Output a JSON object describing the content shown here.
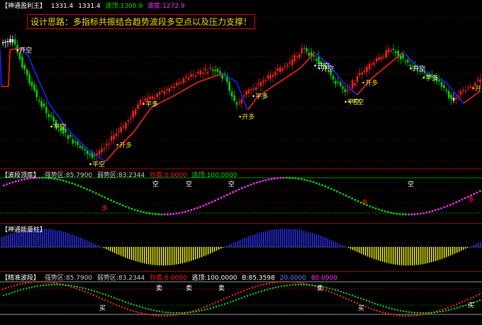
{
  "colors": {
    "up_candle": "#ff2020",
    "down_candle": "#00e000",
    "doji_candle": "#ffffff",
    "ma_up": "#ff2020",
    "ma_down": "#2020ff",
    "title_main": "#ffffff",
    "wave_top": "#00e000",
    "wave_bottom": "#ff30ff",
    "energy_top": "#ffff00",
    "energy_bottom": "#3030ff",
    "grid": "#a00000"
  },
  "panels": {
    "main": {
      "name": "【神通盈利王】",
      "v1": "1331.4",
      "v2": "1331.4",
      "top_label": "波顶:1300.9",
      "bottom_label": "波底:1272.9"
    },
    "wave": {
      "name": "【波段顶底】",
      "strong": "强势区:85.7900",
      "weak": "弱势区:83.2344",
      "bottom": "抄底:0.0000",
      "top": "逃顶:100.0000"
    },
    "energy": {
      "name": "【神通能量柱】"
    },
    "track": {
      "name": "【精准波段】",
      "strong": "强势区:85.7900",
      "weak": "弱势区:83.2344",
      "bottom": "抄底:0.0000",
      "top": "逃顶:100.0000",
      "b": "B:85.3598",
      "v20": "20.0000",
      "v80": "80.0000"
    }
  },
  "banner": {
    "text": "设计思路：多指标共振结合趋势波段多空点以及压力支撑！"
  },
  "signals": [
    {
      "name": "signal-open-short-1",
      "text": "开空",
      "kind": "open-short"
    },
    {
      "name": "signal-close-short-1",
      "text": "平空",
      "kind": "close-short"
    },
    {
      "name": "signal-close-short-2",
      "text": "平空",
      "kind": "close-short"
    },
    {
      "name": "signal-open-long-1",
      "text": "开多",
      "kind": "open-long"
    },
    {
      "name": "signal-close-long-1",
      "text": "平多",
      "kind": "close-long"
    },
    {
      "name": "signal-open-short-2",
      "text": "开空",
      "kind": "open-short"
    },
    {
      "name": "signal-close-short-3",
      "text": "平空",
      "kind": "close-short"
    },
    {
      "name": "signal-open-long-2",
      "text": "开多",
      "kind": "open-long"
    },
    {
      "name": "signal-close-long-2",
      "text": "平多",
      "kind": "close-long"
    },
    {
      "name": "signal-open-short-3",
      "text": "开空",
      "kind": "open-short"
    },
    {
      "name": "signal-close-short-4",
      "text": "平空",
      "kind": "close-short"
    },
    {
      "name": "signal-open-long-3",
      "text": "开多",
      "kind": "open-long"
    },
    {
      "name": "signal-open-short-4",
      "text": "开空",
      "kind": "open-short"
    },
    {
      "name": "signal-close-long-3",
      "text": "平多",
      "kind": "close-long"
    },
    {
      "name": "signal-open-long-4",
      "text": "开多",
      "kind": "open-long"
    }
  ],
  "wave_marks": [
    {
      "text": "空"
    },
    {
      "text": "多"
    },
    {
      "text": "空"
    },
    {
      "text": "空"
    },
    {
      "text": "多"
    },
    {
      "text": "空"
    },
    {
      "text": "多"
    }
  ],
  "track_marks": [
    {
      "text": "买"
    },
    {
      "text": "卖"
    },
    {
      "text": "卖"
    },
    {
      "text": "卖"
    },
    {
      "text": "卖"
    },
    {
      "text": "买"
    },
    {
      "text": "买"
    }
  ]
}
